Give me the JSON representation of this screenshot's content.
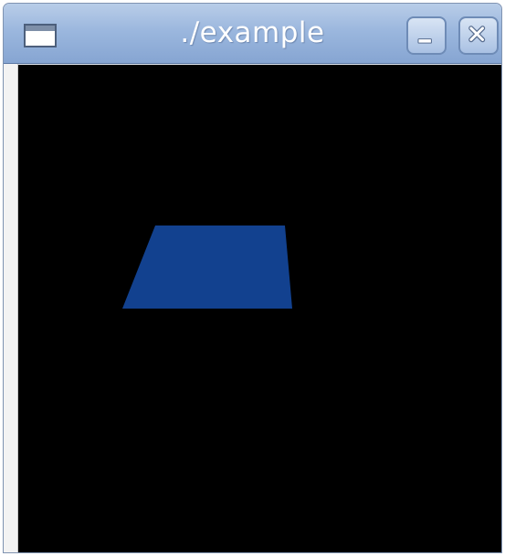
{
  "window": {
    "title": "./example"
  },
  "scene": {
    "background_color": "#000000",
    "shape": "blue-trapezoid",
    "shape_color": "#12418f"
  },
  "controls": {
    "minimize": "minimize-icon",
    "close": "close-icon",
    "window_menu": "window-menu-icon"
  }
}
